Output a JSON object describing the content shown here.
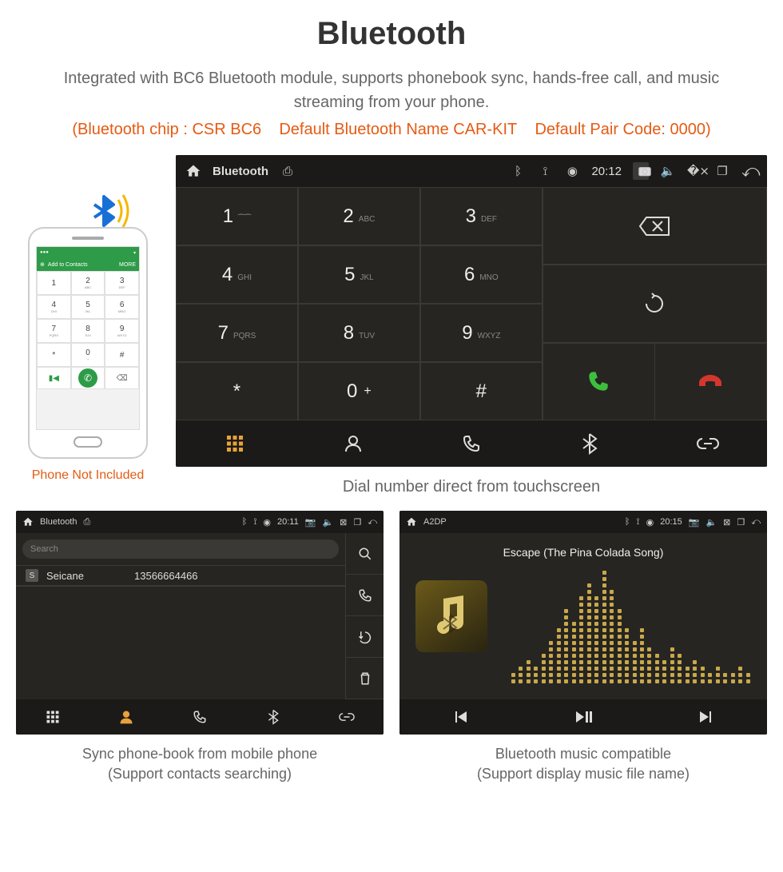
{
  "title": "Bluetooth",
  "subtitle": "Integrated with BC6 Bluetooth module, supports phonebook sync, hands-free call, and music streaming from your phone.",
  "specs": "(Bluetooth chip : CSR BC6    Default Bluetooth Name CAR-KIT    Default Pair Code: 0000)",
  "phone": {
    "add_label": "Add to Contacts",
    "more_label": "MORE",
    "keys": [
      {
        "n": "1",
        "s": ""
      },
      {
        "n": "2",
        "s": "ABC"
      },
      {
        "n": "3",
        "s": "DEF"
      },
      {
        "n": "4",
        "s": "GHI"
      },
      {
        "n": "5",
        "s": "JKL"
      },
      {
        "n": "6",
        "s": "MNO"
      },
      {
        "n": "7",
        "s": "PQRS"
      },
      {
        "n": "8",
        "s": "TUV"
      },
      {
        "n": "9",
        "s": "WXYZ"
      },
      {
        "n": "*",
        "s": ""
      },
      {
        "n": "0",
        "s": "+"
      },
      {
        "n": "#",
        "s": ""
      }
    ],
    "caption": "Phone Not Included"
  },
  "dialer": {
    "top": {
      "title": "Bluetooth",
      "time": "20:12"
    },
    "keys": [
      {
        "n": "1",
        "s": "⁀⁀"
      },
      {
        "n": "2",
        "s": "ABC"
      },
      {
        "n": "3",
        "s": "DEF"
      },
      {
        "n": "4",
        "s": "GHI"
      },
      {
        "n": "5",
        "s": "JKL"
      },
      {
        "n": "6",
        "s": "MNO"
      },
      {
        "n": "7",
        "s": "PQRS"
      },
      {
        "n": "8",
        "s": "TUV"
      },
      {
        "n": "9",
        "s": "WXYZ"
      },
      {
        "n": "*",
        "s": ""
      },
      {
        "n": "0",
        "s": "+"
      },
      {
        "n": "#",
        "s": ""
      }
    ],
    "caption": "Dial number direct from touchscreen"
  },
  "phonebook": {
    "top": {
      "title": "Bluetooth",
      "time": "20:11"
    },
    "search_placeholder": "Search",
    "contact": {
      "badge": "S",
      "name": "Seicane",
      "number": "13566664466"
    },
    "caption_line1": "Sync phone-book from mobile phone",
    "caption_line2": "(Support contacts searching)"
  },
  "music": {
    "top": {
      "title": "A2DP",
      "time": "20:15"
    },
    "song": "Escape (The Pina Colada Song)",
    "caption_line1": "Bluetooth music compatible",
    "caption_line2": "(Support display music file name)"
  }
}
